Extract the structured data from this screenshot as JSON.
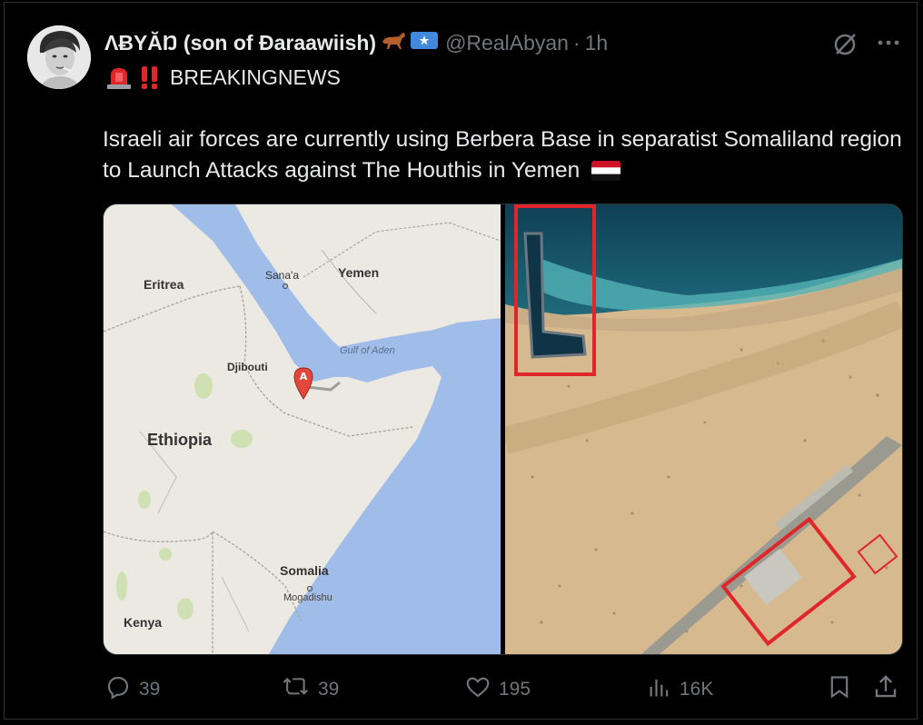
{
  "tweet": {
    "display_name": "ɅɃYĂŊ (son of Ɖaraawiish)",
    "handle": "@RealAbyan",
    "separator": "·",
    "time": "1h",
    "headline": "BREAKINGNEWS",
    "body": "Israeli air forces are currently using Berbera Base in separatist Somaliland region to Launch Attacks against The Houthis in Yemen"
  },
  "map": {
    "labels": {
      "eritrea": "Eritrea",
      "sanaa": "Sana'a",
      "yemen": "Yemen",
      "gulf": "Gulf of Aden",
      "djibouti": "Djibouti",
      "marker": "A",
      "ethiopia": "Ethiopia",
      "somalia": "Somalia",
      "mogadishu": "Mogadishu",
      "kenya": "Kenya"
    }
  },
  "actions": {
    "replies": "39",
    "reposts": "39",
    "likes": "195",
    "views": "16K"
  },
  "colors": {
    "background": "#000000",
    "text": "#e7e9ea",
    "muted": "#71767b",
    "border": "#2f3336",
    "highlight_red": "#e0252b"
  }
}
